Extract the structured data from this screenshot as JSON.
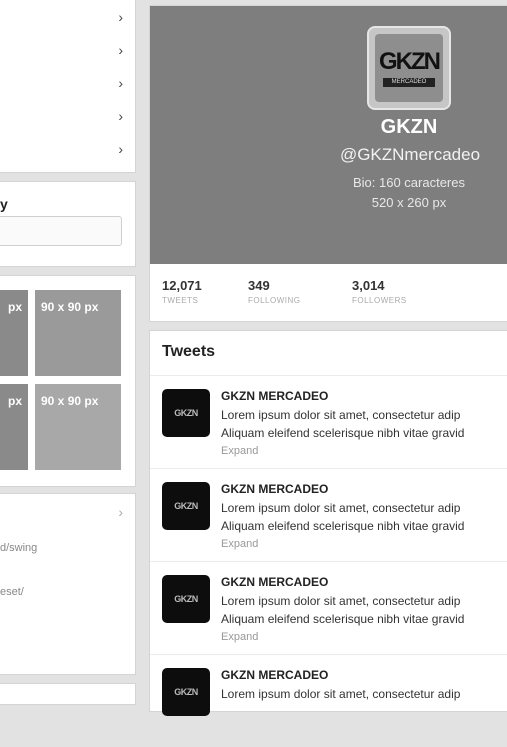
{
  "sidebar": {
    "menu_items": [
      {
        "chevron": "›"
      },
      {
        "chevron": "›"
      },
      {
        "chevron": "›"
      },
      {
        "chevron": "›"
      },
      {
        "chevron": "›"
      }
    ],
    "search_heading": "y",
    "grid_tiles": [
      "px",
      "90 x 90 px",
      "px",
      "90 x 90 px"
    ],
    "follow_chevron": "›",
    "follow_lines": [
      "d/swing",
      "eset/"
    ]
  },
  "profile": {
    "logo_word": "GKZN",
    "logo_sub": "MERCADEO",
    "name": "GKZN",
    "handle": "@GKZNmercadeo",
    "bio": "Bio: 160 caracteres",
    "cover_size": "520 x 260 px",
    "stats": [
      {
        "count": "12,071",
        "label": "TWEETS"
      },
      {
        "count": "349",
        "label": "FOLLOWING"
      },
      {
        "count": "3,014",
        "label": "FOLLOWERS"
      }
    ]
  },
  "tweets": {
    "title": "Tweets",
    "items": [
      {
        "avatar": "GKZN",
        "author": "GKZN MERCADEO",
        "line1": "Lorem ipsum dolor sit amet, consectetur adip",
        "line2": "Aliquam eleifend scelerisque nibh vitae gravid",
        "expand": "Expand"
      },
      {
        "avatar": "GKZN",
        "author": "GKZN MERCADEO",
        "line1": "Lorem ipsum dolor sit amet, consectetur adip",
        "line2": "Aliquam eleifend scelerisque nibh vitae gravid",
        "expand": "Expand"
      },
      {
        "avatar": "GKZN",
        "author": "GKZN MERCADEO",
        "line1": "Lorem ipsum dolor sit amet, consectetur adip",
        "line2": "Aliquam eleifend scelerisque nibh vitae gravid",
        "expand": "Expand"
      },
      {
        "avatar": "GKZN",
        "author": "GKZN MERCADEO",
        "line1": "Lorem ipsum dolor sit amet, consectetur adip",
        "line2": "",
        "expand": ""
      }
    ]
  }
}
